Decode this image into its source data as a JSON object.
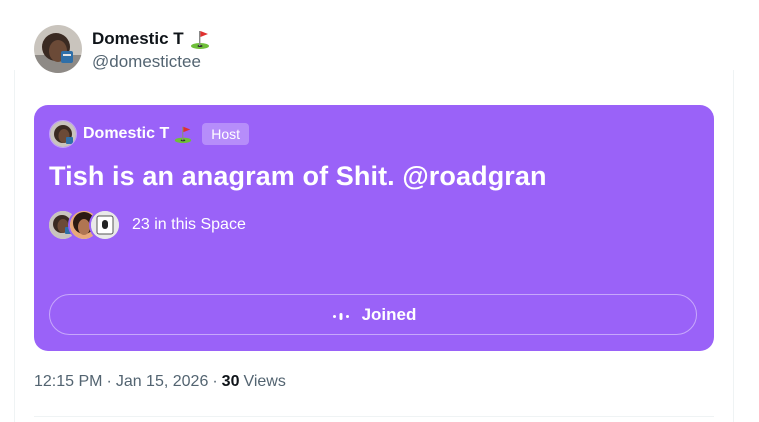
{
  "author": {
    "name": "Domestic T",
    "handle": "@domestictee",
    "name_emoji": "golf-flag-icon"
  },
  "space": {
    "background_color": "#9a62f8",
    "host_name": "Domestic T",
    "host_badge": "Host",
    "title": "Tish is an anagram of Shit. @roadgran",
    "listeners_text": "23 in this Space",
    "button_label": "Joined"
  },
  "meta": {
    "time": "12:15 PM",
    "separator": "·",
    "date": "Jan 15, 2026",
    "views_count": "30",
    "views_label": "Views"
  }
}
